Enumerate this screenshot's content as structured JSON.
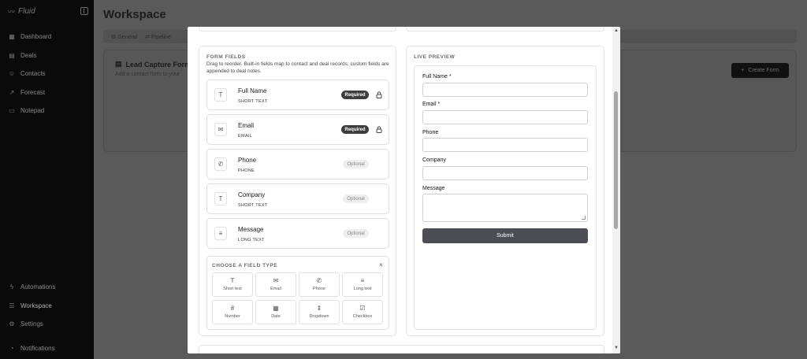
{
  "sidebar": {
    "brand": "Fluid",
    "items": [
      {
        "label": "Dashboard",
        "icon": "grid-icon"
      },
      {
        "label": "Deals",
        "icon": "deals-icon"
      },
      {
        "label": "Contacts",
        "icon": "users-icon"
      },
      {
        "label": "Forecast",
        "icon": "trend-icon"
      },
      {
        "label": "Notepad",
        "icon": "note-icon"
      }
    ],
    "bottom_items": [
      {
        "label": "Automations",
        "icon": "bolt-icon"
      },
      {
        "label": "Workspace",
        "icon": "sliders-icon"
      },
      {
        "label": "Settings",
        "icon": "gear-icon"
      },
      {
        "label": "Notifications",
        "icon": "bell-icon"
      }
    ]
  },
  "workspace": {
    "title": "Workspace",
    "tabs": [
      "General",
      "Pipeline"
    ],
    "card_title": "Lead Capture Form",
    "card_subtitle": "Add a contact form to your",
    "create_button": "Create Form"
  },
  "form_fields": {
    "heading": "FORM FIELDS",
    "description": "Drag to reorder. Built-in fields map to contact and deal records; custom fields are appended to deal notes.",
    "fields": [
      {
        "name": "Full Name",
        "type": "SHORT TEXT",
        "badge": "Required",
        "required": true,
        "icon": "text-icon",
        "glyph": "T"
      },
      {
        "name": "Email",
        "type": "EMAIL",
        "badge": "Required",
        "required": true,
        "icon": "mail-icon",
        "glyph": "✉"
      },
      {
        "name": "Phone",
        "type": "PHONE",
        "badge": "Optional",
        "required": false,
        "icon": "phone-icon",
        "glyph": "✆"
      },
      {
        "name": "Company",
        "type": "SHORT TEXT",
        "badge": "Optional",
        "required": false,
        "icon": "text-icon",
        "glyph": "T"
      },
      {
        "name": "Message",
        "type": "LONG TEXT",
        "badge": "Optional",
        "required": false,
        "icon": "long-text-icon",
        "glyph": "≡"
      }
    ]
  },
  "chooser": {
    "title": "CHOOSE A FIELD TYPE",
    "close": "×",
    "types": [
      {
        "label": "Short text",
        "glyph": "T",
        "icon": "text-icon"
      },
      {
        "label": "Email",
        "glyph": "✉",
        "icon": "mail-icon"
      },
      {
        "label": "Phone",
        "glyph": "✆",
        "icon": "phone-icon"
      },
      {
        "label": "Long text",
        "glyph": "≡",
        "icon": "long-text-icon"
      },
      {
        "label": "Number",
        "glyph": "#",
        "icon": "hash-icon"
      },
      {
        "label": "Date",
        "glyph": "▦",
        "icon": "calendar-icon"
      },
      {
        "label": "Dropdown",
        "glyph": "⇕",
        "icon": "dropdown-icon"
      },
      {
        "label": "Checkbox",
        "glyph": "☑",
        "icon": "checkbox-icon"
      }
    ]
  },
  "preview": {
    "heading": "LIVE PREVIEW",
    "labels": {
      "full_name": "Full Name *",
      "email": "Email *",
      "phone": "Phone",
      "company": "Company",
      "message": "Message"
    },
    "submit": "Submit"
  }
}
